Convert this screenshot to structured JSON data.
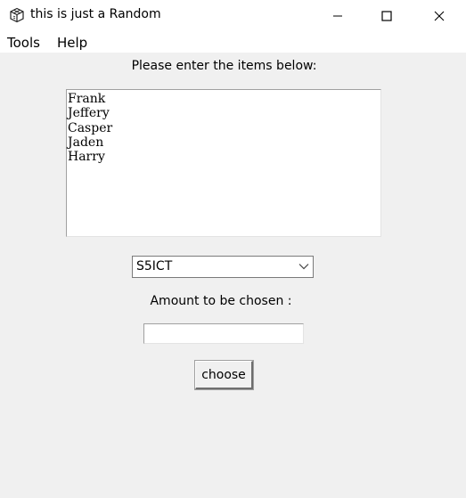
{
  "window": {
    "title": "this is just a Random",
    "app_icon": "cube-icon",
    "controls": [
      "minimize-icon",
      "maximize-icon",
      "close-icon"
    ]
  },
  "menubar": {
    "items": [
      {
        "label": "Tools"
      },
      {
        "label": "Help"
      }
    ]
  },
  "main": {
    "prompt": "Please enter the items below:",
    "items_text": [
      "Frank",
      "Jeffery",
      "Casper",
      "Jaden",
      "Harry"
    ],
    "class_select": {
      "selected": "S5ICT",
      "icon": "chevron-down-icon"
    },
    "amount_label": "Amount to be chosen :",
    "amount_input": {
      "value": "",
      "placeholder": ""
    },
    "choose_button_label": "choose"
  }
}
